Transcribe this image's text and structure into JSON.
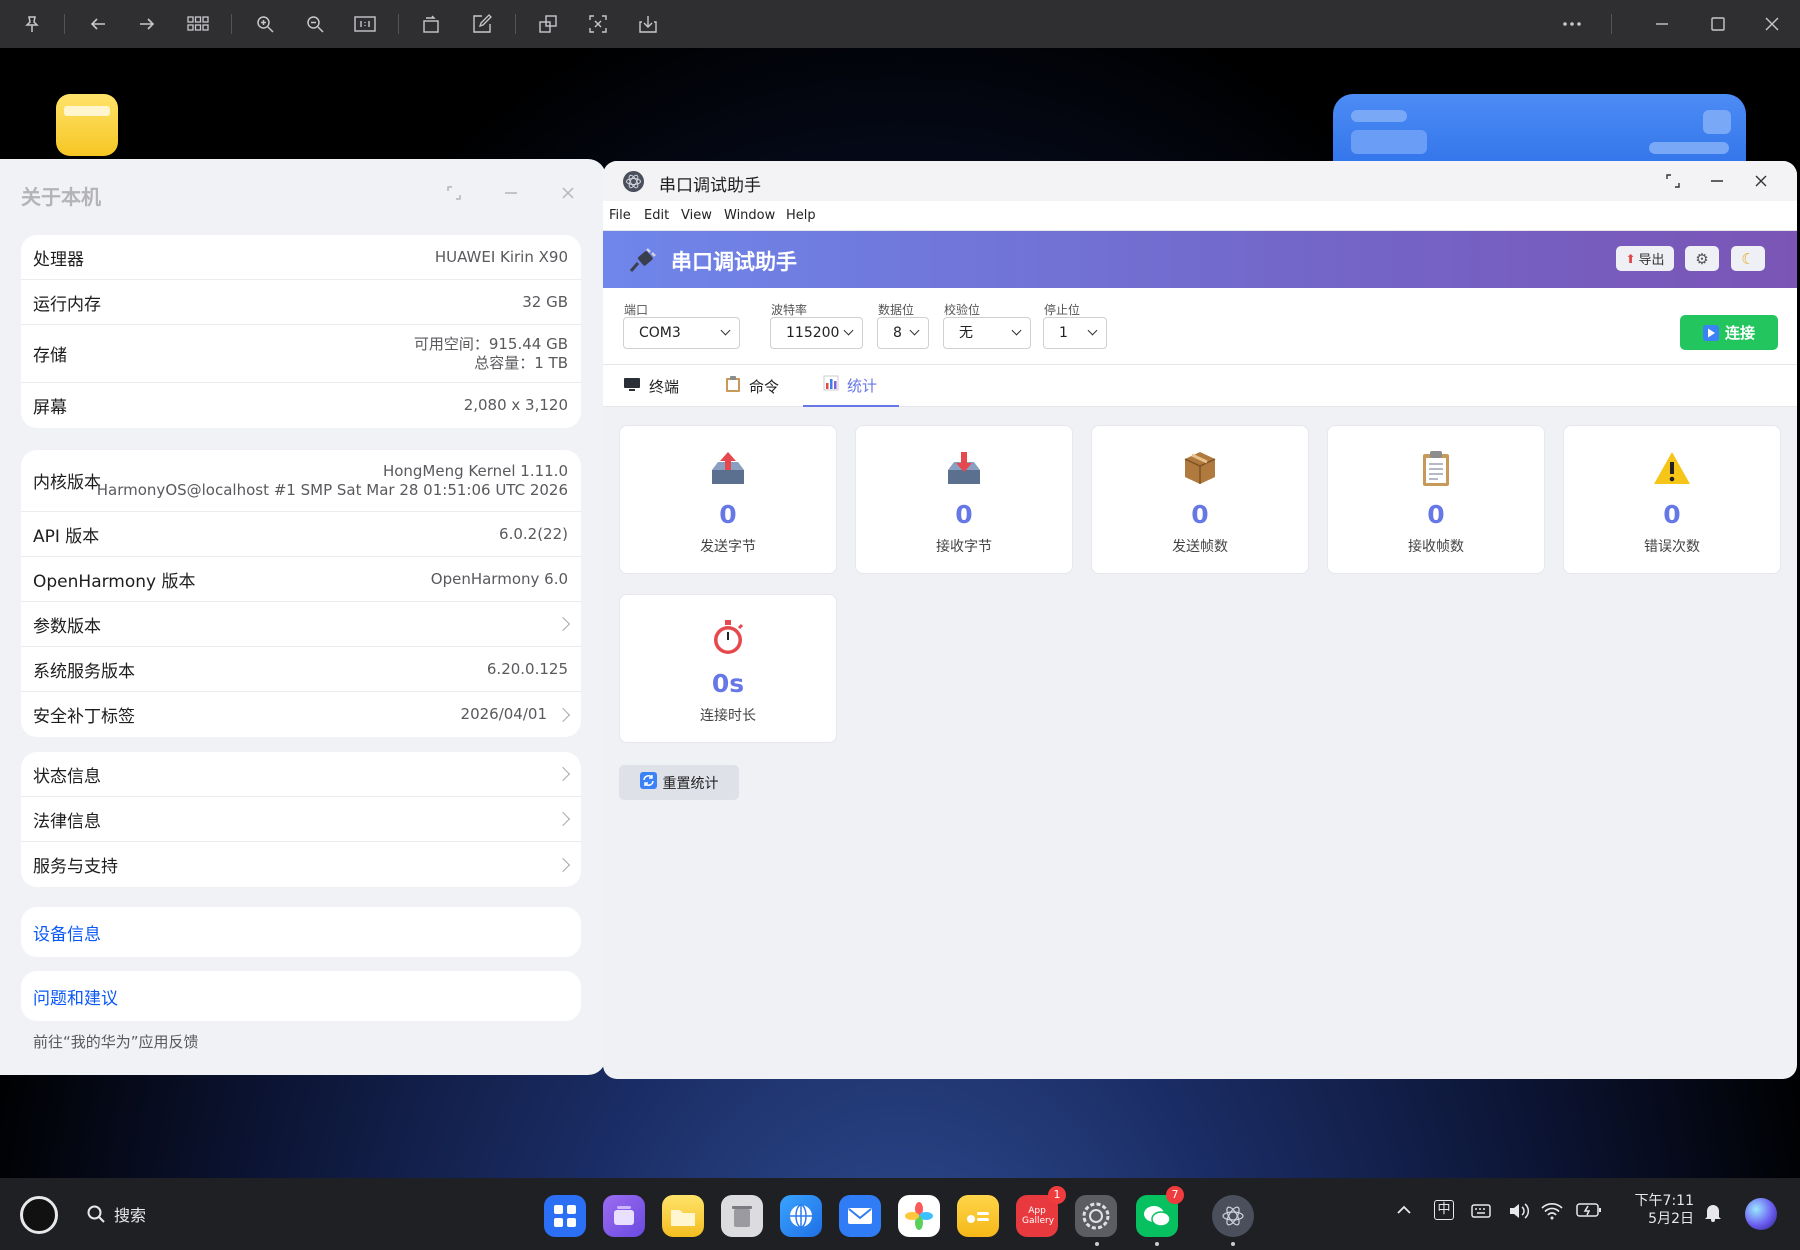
{
  "viewer_toolbar": {
    "icons": [
      "pin-icon",
      "back-icon",
      "forward-icon",
      "grid-icon",
      "zoom-in-icon",
      "zoom-out-icon",
      "actual-size-icon",
      "rotate-icon",
      "edit-icon",
      "extract-icon",
      "crop-icon",
      "download-icon",
      "more-icon",
      "minimize-icon",
      "maximize-icon",
      "close-icon"
    ]
  },
  "about_window": {
    "title": "关于本机",
    "group1": [
      {
        "label": "处理器",
        "value": "HUAWEI Kirin X90"
      },
      {
        "label": "运行内存",
        "value": "32 GB"
      },
      {
        "label": "存储",
        "value_line1": "可用空间：915.44 GB",
        "value_line2": "总容量：1 TB"
      },
      {
        "label": "屏幕",
        "value": "2,080 x 3,120"
      }
    ],
    "group2": [
      {
        "label": "内核版本",
        "value_line1": "HongMeng Kernel 1.11.0",
        "value_line2": "HarmonyOS@localhost #1 SMP Sat Mar 28 01:51:06 UTC 2026"
      },
      {
        "label": "API 版本",
        "value": "6.0.2(22)"
      },
      {
        "label": "OpenHarmony 版本",
        "value": "OpenHarmony 6.0"
      },
      {
        "label": "参数版本",
        "value": ""
      },
      {
        "label": "系统服务版本",
        "value": "6.20.0.125"
      },
      {
        "label": "安全补丁标签",
        "value": "2026/04/01"
      }
    ],
    "group3": [
      {
        "label": "状态信息"
      },
      {
        "label": "法律信息"
      },
      {
        "label": "服务与支持"
      }
    ],
    "device_info": "设备信息",
    "feedback": "问题和建议",
    "feedback_hint": "前往“我的华为”应用反馈"
  },
  "serial_window": {
    "title": "串口调试助手",
    "menu": [
      "File",
      "Edit",
      "View",
      "Window",
      "Help"
    ],
    "banner_title": "串口调试助手",
    "export_label": "导出",
    "config": {
      "port": {
        "label": "端口",
        "value": "COM3"
      },
      "baud": {
        "label": "波特率",
        "value": "115200"
      },
      "data_bits": {
        "label": "数据位",
        "value": "8"
      },
      "parity": {
        "label": "校验位",
        "value": "无"
      },
      "stop_bits": {
        "label": "停止位",
        "value": "1"
      }
    },
    "connect_label": "连接",
    "tabs": [
      {
        "label": "终端",
        "icon": "monitor-icon"
      },
      {
        "label": "命令",
        "icon": "clipboard-icon"
      },
      {
        "label": "统计",
        "icon": "chart-icon"
      }
    ],
    "stats": [
      {
        "label": "发送字节",
        "value": "0",
        "icon": "outbox-icon"
      },
      {
        "label": "接收字节",
        "value": "0",
        "icon": "inbox-icon"
      },
      {
        "label": "发送帧数",
        "value": "0",
        "icon": "package-icon"
      },
      {
        "label": "接收帧数",
        "value": "0",
        "icon": "clipboard-icon"
      },
      {
        "label": "错误次数",
        "value": "0",
        "icon": "warning-icon"
      },
      {
        "label": "连接时长",
        "value": "0s",
        "icon": "stopwatch-icon"
      }
    ],
    "reset_label": "重置统计"
  },
  "taskbar": {
    "search_label": "搜索",
    "badges": {
      "app_gallery": "1",
      "wechat": "7"
    },
    "app_gallery_label": "App Gallery",
    "ime_label": "中",
    "time": "下午7:11",
    "date": "5月2日"
  }
}
